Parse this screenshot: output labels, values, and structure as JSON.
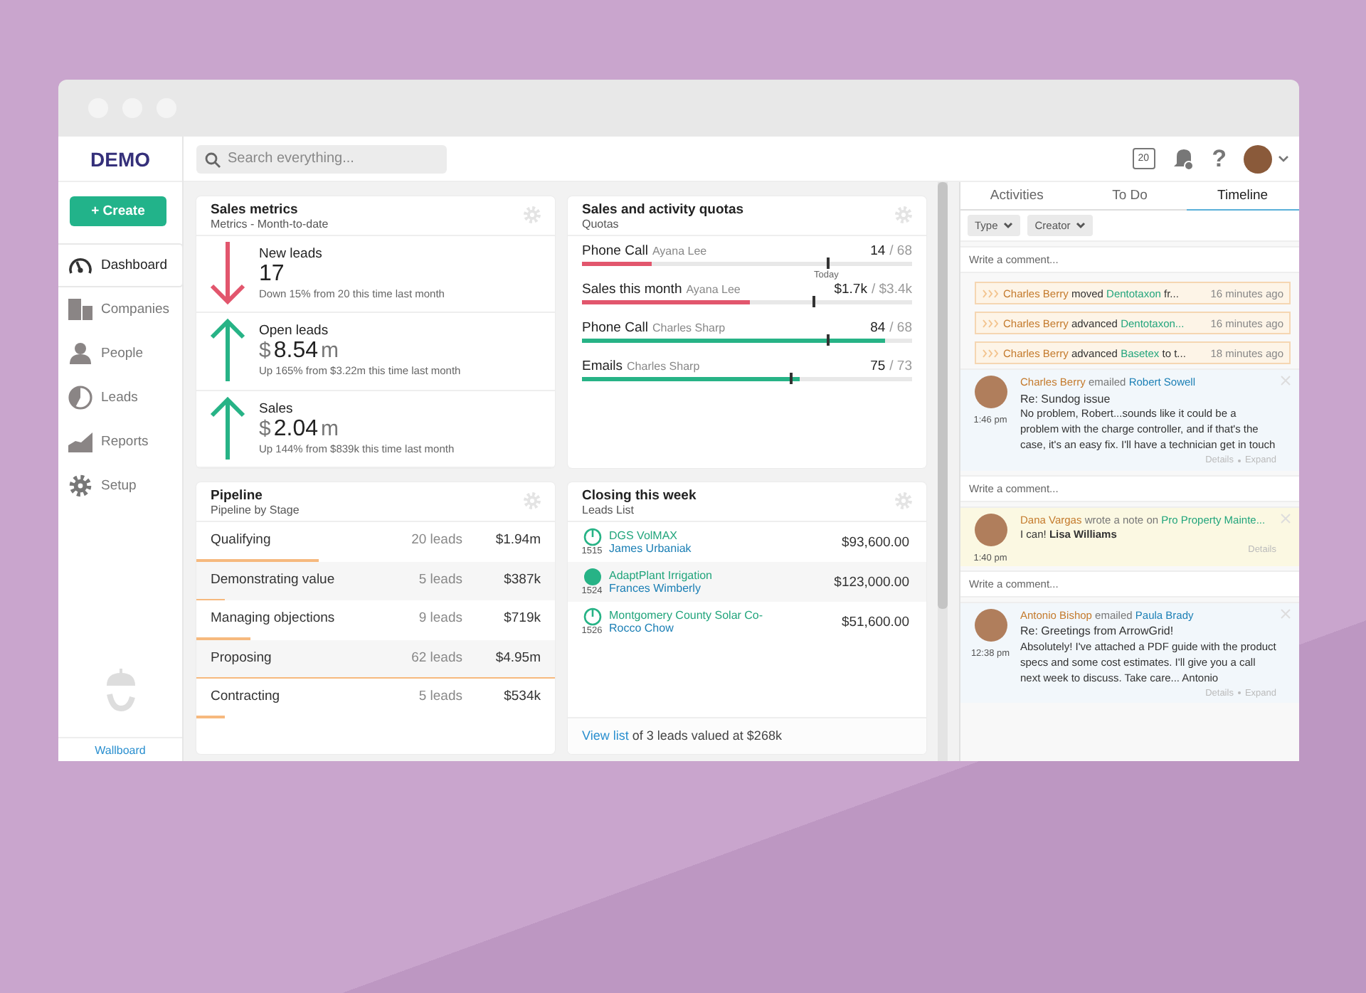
{
  "header": {
    "logo": "DEMO",
    "search_placeholder": "Search everything...",
    "calendar_day": "20",
    "help": "?"
  },
  "sidebar": {
    "create_button": "+ Create",
    "items": [
      {
        "label": "Dashboard",
        "selected": true
      },
      {
        "label": "Companies",
        "selected": false
      },
      {
        "label": "People",
        "selected": false
      },
      {
        "label": "Leads",
        "selected": false
      },
      {
        "label": "Reports",
        "selected": false
      },
      {
        "label": "Setup",
        "selected": false
      }
    ],
    "footer_link": "Wallboard"
  },
  "sales_metrics": {
    "title": "Sales metrics",
    "subtitle": "Metrics - Month-to-date",
    "items": [
      {
        "label": "New leads",
        "kind": "decrease",
        "value": "17",
        "note": "Down 15% from 20 this time last month"
      },
      {
        "label": "Open leads",
        "kind": "increase",
        "currency": "$",
        "value": "8.54",
        "unit": "m",
        "note": "Up 165% from $3.22m this time last month"
      },
      {
        "label": "Sales",
        "kind": "increase",
        "currency": "$",
        "value": "2.04",
        "unit": "m",
        "note": "Up 144% from $839k this time last month"
      }
    ]
  },
  "quotas": {
    "title": "Sales and activity quotas",
    "subtitle": "Quotas",
    "items": [
      {
        "activity": "Phone Call",
        "owner": "Ayana Lee",
        "value": "14",
        "target": "/ 68",
        "color": "#e2566d",
        "level": 0.21,
        "today_marker": {
          "level": 0.74,
          "label": "Today"
        }
      },
      {
        "activity": "Sales this month",
        "owner": "Ayana Lee",
        "value": "$1.7k",
        "target": "/ $3.4k",
        "color": "#e2566d",
        "level": 0.51,
        "today_marker": {
          "level": 0.7
        }
      },
      {
        "activity": "Phone Call",
        "owner": "Charles Sharp",
        "value": "84",
        "target": "/ 68",
        "color": "#27b386",
        "level": 0.92,
        "today_marker": {
          "level": 0.74
        }
      },
      {
        "activity": "Emails",
        "owner": "Charles Sharp",
        "value": "75",
        "target": "/ 73",
        "color": "#27b386",
        "level": 0.66,
        "today_marker": {
          "level": 0.63
        }
      }
    ]
  },
  "pipeline": {
    "title": "Pipeline",
    "subtitle": "Pipeline by Stage",
    "stages": [
      {
        "name": "Qualifying",
        "count": "20 leads",
        "value": "$1.94m",
        "level": 0.34
      },
      {
        "name": "Demonstrating value",
        "count": "5 leads",
        "value": "$387k",
        "level": 0.08
      },
      {
        "name": "Managing objections",
        "count": "9 leads",
        "value": "$719k",
        "level": 0.15
      },
      {
        "name": "Proposing",
        "count": "62 leads",
        "value": "$4.95m",
        "level": 1.0
      },
      {
        "name": "Contracting",
        "count": "5 leads",
        "value": "$534k",
        "level": 0.08
      }
    ]
  },
  "closing": {
    "title": "Closing this week",
    "subtitle": "Leads List",
    "leads": [
      {
        "kind": "open",
        "number": "1515",
        "company": "DGS VolMAX",
        "contact": "James Urbaniak",
        "amount": "$93,600.00"
      },
      {
        "kind": "filled",
        "number": "1524",
        "company": "AdaptPlant Irrigation",
        "contact": "Frances Wimberly",
        "amount": "$123,000.00"
      },
      {
        "kind": "open",
        "number": "1526",
        "company": "Montgomery County Solar Co-",
        "contact": "Rocco Chow",
        "amount": "$51,600.00"
      }
    ],
    "footer_link": "View list",
    "footer_text": "of 3 leads valued at $268k"
  },
  "timeline": {
    "tabs": [
      {
        "label": "Activities",
        "selected": false
      },
      {
        "label": "To Do",
        "selected": false
      },
      {
        "label": "Timeline",
        "selected": true
      }
    ],
    "filters": [
      "Type",
      "Creator"
    ],
    "comment_placeholder": "Write a comment...",
    "events": [
      {
        "actor": "Charles Berry",
        "verb": "moved",
        "target": "Dentotaxon",
        "rest": "fr...",
        "time": "16 minutes ago"
      },
      {
        "actor": "Charles Berry",
        "verb": "advanced",
        "target": "Dentotaxon...",
        "time": "16 minutes ago"
      },
      {
        "actor": "Charles Berry",
        "verb": "advanced",
        "target": "Basetex",
        "rest": "to t...",
        "time": "18 minutes ago"
      }
    ],
    "entries": [
      {
        "kind": "email",
        "author": "Charles Berry",
        "verb": "emailed",
        "recipient": "Robert Sowell",
        "subject": "Re: Sundog issue",
        "time": "1:46 pm",
        "body": "No problem, Robert...sounds like it could be a problem with the charge controller, and if that's the case, it's an easy fix. I'll have a technician get in touch",
        "links": [
          "Details",
          "Expand"
        ],
        "comment_placeholder": "Write a comment..."
      },
      {
        "kind": "note",
        "author": "Dana Vargas",
        "verb": "wrote a note on",
        "recipient": "Pro Property Mainte...",
        "body": "I can! **Lisa Williams**",
        "time": "1:40 pm",
        "links": [
          "Details"
        ],
        "comment_placeholder": "Write a comment..."
      },
      {
        "kind": "email",
        "author": "Antonio Bishop",
        "verb": "emailed",
        "recipient": "Paula Brady",
        "subject": "Re: Greetings from ArrowGrid!",
        "time": "12:38 pm",
        "body": "Absolutely! I've attached a PDF guide with the product specs and some cost estimates. I'll give you a call next week to discuss. Take care... Antonio",
        "links": [
          "Details",
          "Expand"
        ]
      }
    ]
  }
}
